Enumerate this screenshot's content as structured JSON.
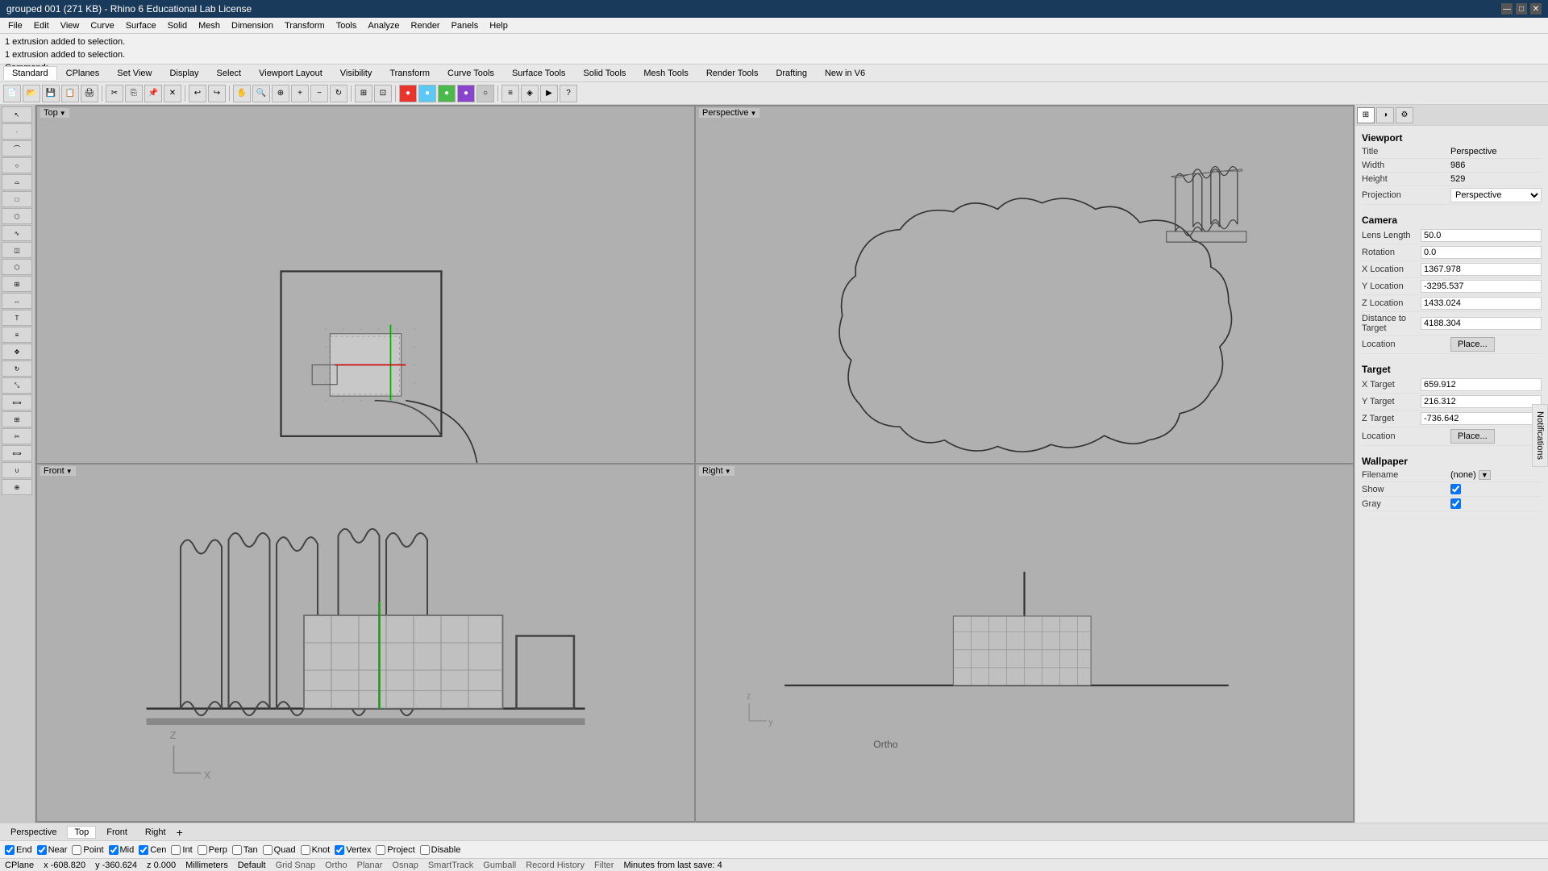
{
  "titlebar": {
    "title": "grouped 001 (271 KB) - Rhino 6 Educational Lab License",
    "minimize": "—",
    "maximize": "□",
    "close": "✕"
  },
  "menubar": {
    "items": [
      "File",
      "Edit",
      "View",
      "Curve",
      "Surface",
      "Solid",
      "Mesh",
      "Dimension",
      "Transform",
      "Tools",
      "Analyze",
      "Render",
      "Panels",
      "Help"
    ]
  },
  "infobar": {
    "line1": "1 extrusion added to selection.",
    "line2": "1 extrusion added to selection.",
    "line3": "Command:"
  },
  "toolbar_tabs": {
    "items": [
      "Standard",
      "CPlanes",
      "Set View",
      "Display",
      "Select",
      "Viewport Layout",
      "Visibility",
      "Transform",
      "Curve Tools",
      "Surface Tools",
      "Solid Tools",
      "Mesh Tools",
      "Render Tools",
      "Drafting",
      "New in V6"
    ]
  },
  "viewports": {
    "top": {
      "label": "Top",
      "dropdown": "▼"
    },
    "perspective": {
      "label": "Perspective",
      "dropdown": "▼"
    },
    "front": {
      "label": "Front",
      "dropdown": "▼"
    },
    "right": {
      "label": "Right",
      "dropdown": "▼"
    }
  },
  "right_panel": {
    "viewport_section": {
      "title": "Viewport",
      "rows": [
        {
          "label": "Title",
          "value": "Perspective"
        },
        {
          "label": "Width",
          "value": "986"
        },
        {
          "label": "Height",
          "value": "529"
        },
        {
          "label": "Projection",
          "value": "Perspective"
        }
      ]
    },
    "camera_section": {
      "title": "Camera",
      "rows": [
        {
          "label": "Lens Length",
          "value": "50.0"
        },
        {
          "label": "Rotation",
          "value": "0.0"
        },
        {
          "label": "X Location",
          "value": "1367.978"
        },
        {
          "label": "Y Location",
          "value": "-3295.537"
        },
        {
          "label": "Z Location",
          "value": "1433.024"
        },
        {
          "label": "Distance to Target",
          "value": "4188.304"
        },
        {
          "label": "Location",
          "value": "Place...",
          "is_button": true
        }
      ]
    },
    "target_section": {
      "title": "Target",
      "rows": [
        {
          "label": "X Target",
          "value": "659.912"
        },
        {
          "label": "Y Target",
          "value": "216.312"
        },
        {
          "label": "Z Target",
          "value": "-736.642"
        },
        {
          "label": "Location",
          "value": "Place...",
          "is_button": true
        }
      ]
    },
    "wallpaper_section": {
      "title": "Wallpaper",
      "rows": [
        {
          "label": "Filename",
          "value": "(none)"
        },
        {
          "label": "Show",
          "value": true,
          "is_checkbox": true
        },
        {
          "label": "Gray",
          "value": true,
          "is_checkbox": true
        }
      ]
    }
  },
  "viewport_tabs": {
    "items": [
      "Perspective",
      "Top",
      "Front",
      "Right"
    ],
    "add_label": "+"
  },
  "statusbar": {
    "checkboxes": [
      {
        "label": "End",
        "checked": true
      },
      {
        "label": "Near",
        "checked": true
      },
      {
        "label": "Point",
        "checked": false
      },
      {
        "label": "Mid",
        "checked": true
      },
      {
        "label": "Cen",
        "checked": true
      },
      {
        "label": "Int",
        "checked": false
      },
      {
        "label": "Perp",
        "checked": false
      },
      {
        "label": "Tan",
        "checked": false
      },
      {
        "label": "Quad",
        "checked": false
      },
      {
        "label": "Knot",
        "checked": false
      },
      {
        "label": "Vertex",
        "checked": true
      },
      {
        "label": "Project",
        "checked": false
      },
      {
        "label": "Disable",
        "checked": false
      }
    ]
  },
  "bottombar": {
    "cplane": "CPlane",
    "x": "x -608.820",
    "y": "y -360.624",
    "z": "z 0.000",
    "units": "Millimeters",
    "default": "Default",
    "grid_snap": "Grid Snap",
    "ortho": "Ortho",
    "planar": "Planar",
    "osnap": "Osnap",
    "smart_track": "SmartTrack",
    "gumball": "Gumball",
    "record_history": "Record History",
    "filter": "Filter",
    "minutes": "Minutes from last save: 4"
  },
  "notifications": "Notifications"
}
